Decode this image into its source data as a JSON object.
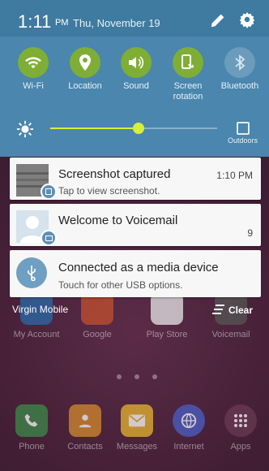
{
  "status": {
    "time": "1:11",
    "ampm": "PM",
    "date": "Thu, November 19"
  },
  "quick_settings": [
    {
      "label": "Wi-Fi",
      "icon": "wifi-icon",
      "state": "on"
    },
    {
      "label": "Location",
      "icon": "location-pin-icon",
      "state": "on"
    },
    {
      "label": "Sound",
      "icon": "speaker-icon",
      "state": "on"
    },
    {
      "label": "Screen rotation",
      "line1": "Screen",
      "line2": "rotation",
      "icon": "screen-rotation-icon",
      "state": "on"
    },
    {
      "label": "Bluetooth",
      "icon": "bluetooth-icon",
      "state": "off"
    }
  ],
  "brightness": {
    "level": 0.53,
    "outdoors_label": "Outdoors"
  },
  "notifications": [
    {
      "title": "Screenshot captured",
      "subtitle": "Tap to view screenshot.",
      "time": "1:10 PM",
      "icon": "screenshot-thumbnail"
    },
    {
      "title": "Welcome to Voicemail",
      "subtitle": "",
      "count": "9",
      "icon": "contact-avatar-icon"
    },
    {
      "title": "Connected as a media device",
      "subtitle": "Touch for other USB options.",
      "icon": "usb-icon"
    }
  ],
  "carrier": "Virgin Mobile",
  "clear_label": "Clear",
  "home": {
    "row1": [
      "My Account",
      "Google",
      "Play Store",
      "Voicemail"
    ],
    "dock": [
      "Phone",
      "Contacts",
      "Messages",
      "Internet",
      "Apps"
    ]
  },
  "colors": {
    "panel": "#4a86ad",
    "accent_green": "#7fae36",
    "slider": "#d7ef3a"
  }
}
